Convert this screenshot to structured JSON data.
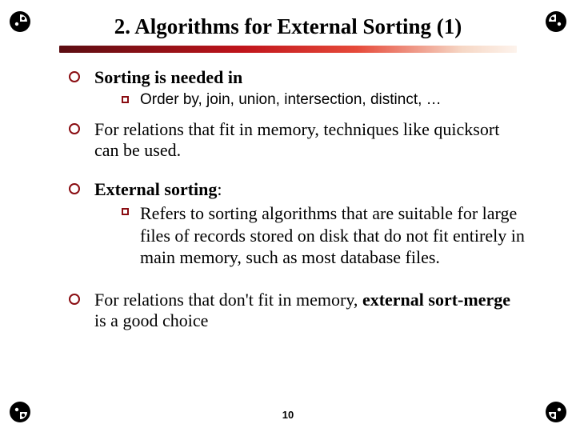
{
  "icons": {
    "corner_name": "flip-icon"
  },
  "title": "2. Algorithms for External Sorting (1)",
  "bullets": {
    "b1": {
      "text": "Sorting is needed in",
      "sub1": "Order by, join, union, intersection, distinct, …"
    },
    "b2": {
      "text": "For relations that fit in memory, techniques like quicksort can be used."
    },
    "b3": {
      "lead_bold": "External sorting",
      "lead_tail": ":",
      "sub1": "Refers to sorting algorithms that are suitable for large files of records stored on disk that do not fit entirely in main memory, such as most database files."
    },
    "b4": {
      "pre": "For relations that don't fit in memory, ",
      "bold": "external sort-merge",
      "post": " is a good choice"
    }
  },
  "page_number": "10"
}
